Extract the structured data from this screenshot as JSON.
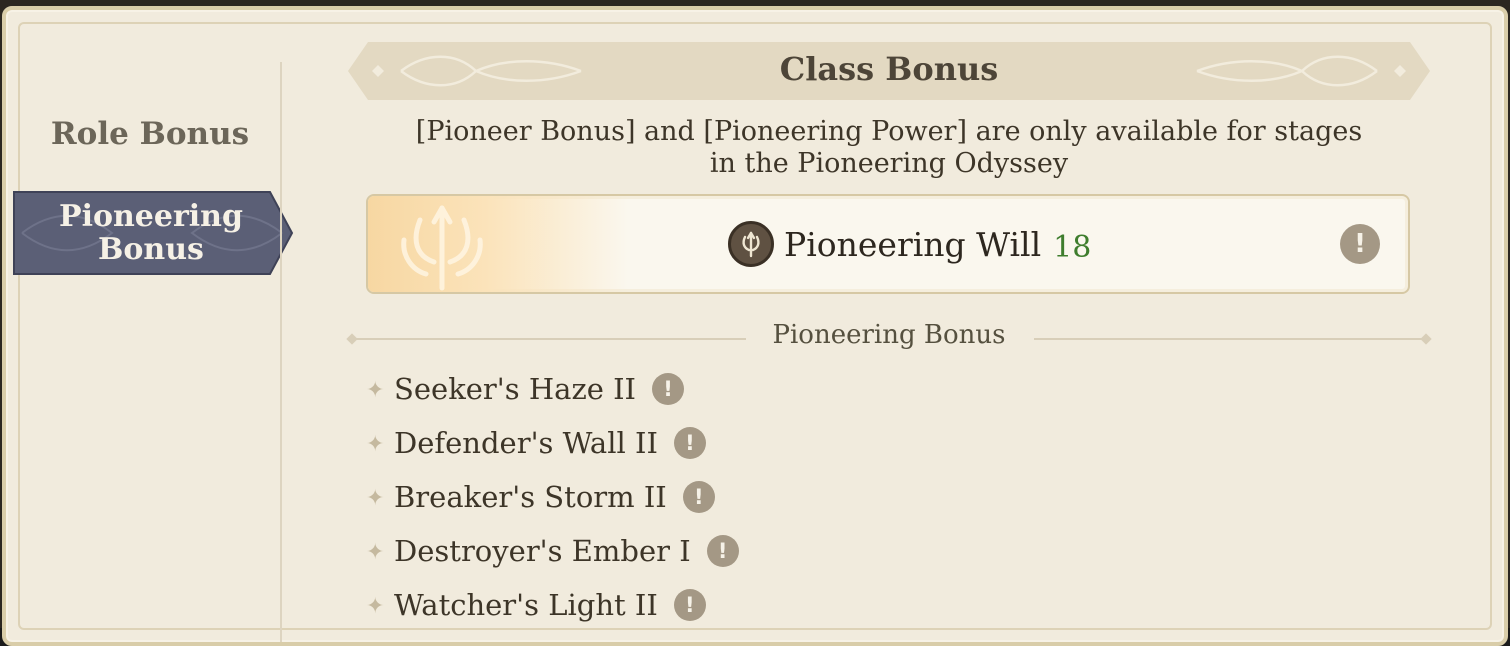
{
  "sidebar": {
    "tabs": [
      {
        "label": "Role Bonus",
        "active": false
      },
      {
        "label": "Pioneering Bonus",
        "line1": "Pioneering",
        "line2": "Bonus",
        "active": true
      }
    ]
  },
  "header": {
    "title": "Class Bonus"
  },
  "notice": {
    "line1": "[Pioneer Bonus] and [Pioneering Power] are only available for stages",
    "line2": "in the Pioneering Odyssey"
  },
  "will": {
    "icon": "trident-emblem-icon",
    "label": "Pioneering Will",
    "value": "18",
    "info_icon": "exclamation-info-icon"
  },
  "section": {
    "title": "Pioneering Bonus"
  },
  "bonuses": [
    {
      "name": "Seeker's Haze II"
    },
    {
      "name": "Defender's Wall II"
    },
    {
      "name": "Breaker's Storm II"
    },
    {
      "name": "Destroyer's Ember I"
    },
    {
      "name": "Watcher's Light II"
    }
  ],
  "colors": {
    "panel": "#f1ebdd",
    "active_tab": "#5b5f76",
    "accent_value": "#3e7d2d",
    "info_badge": "#a49885"
  }
}
